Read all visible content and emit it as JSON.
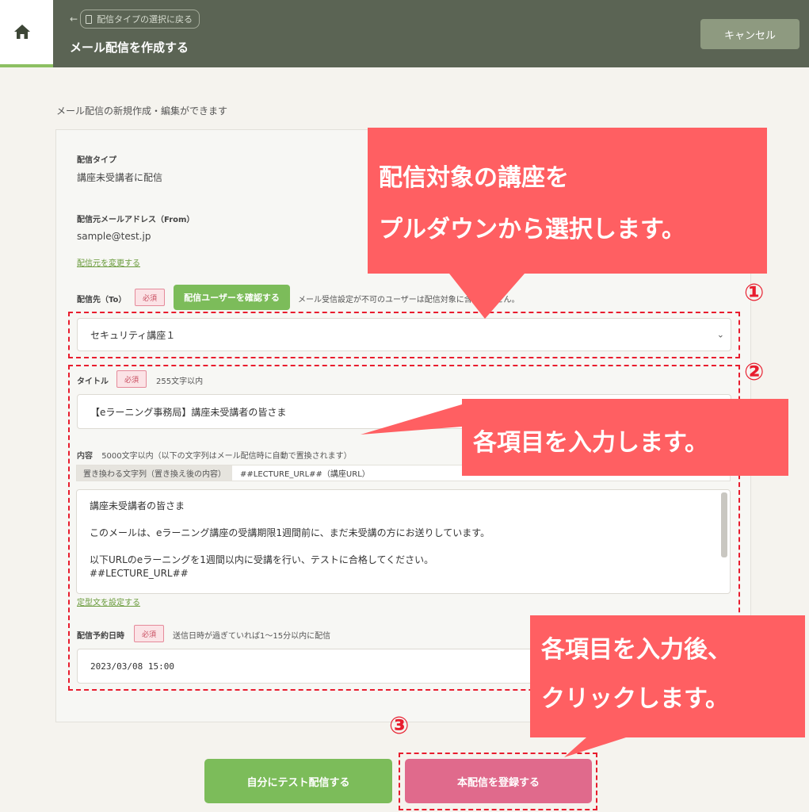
{
  "header": {
    "back_label": "配信タイプの選択に戻る",
    "back_arrow": "←",
    "title": "メール配信を作成する",
    "cancel_label": "キャンセル"
  },
  "subtitle": "メール配信の新規作成・編集ができます",
  "form": {
    "type_label": "配信タイプ",
    "type_value": "講座未受講者に配信",
    "from_label": "配信元メールアドレス（From）",
    "from_value": "sample@test.jp",
    "change_from_link": "配信元を変更する",
    "to_label": "配信先（To）",
    "required": "必須",
    "confirm_users_button": "配信ユーザーを確認する",
    "to_note": "メール受信設定が不可のユーザーは配信対象に含まれません。",
    "course_select": "セキュリティ講座１",
    "course_chevron": "⌄",
    "title_label": "タイトル",
    "title_note": "255文字以内",
    "title_value": "【eラーニング事務局】講座未受講者の皆さま",
    "content_label": "内容",
    "content_note": "5000文字以内（以下の文字列はメール配信時に自動で置換されます）",
    "replace_head": "置き換わる文字列（置き換え後の内容）",
    "replace_value": "##LECTURE_URL##（講座URL）",
    "body_lines": [
      "講座未受講者の皆さま",
      "このメールは、eラーニング講座の受講期限1週間前に、まだ未受講の方にお送りしています。",
      "以下URLのeラーニングを1週間以内に受講を行い、テストに合格してください。",
      "##LECTURE_URL##"
    ],
    "template_link": "定型文を設定する",
    "schedule_label": "配信予約日時",
    "schedule_note": "送信日時が過ぎていれば1〜15分以内に配信",
    "schedule_value": "2023/03/08 15:00"
  },
  "buttons": {
    "test_send": "自分にテスト配信する",
    "register": "本配信を登録する"
  },
  "annotations": {
    "num1": "①",
    "num2": "②",
    "num3": "③",
    "callout1_line1": "配信対象の講座を",
    "callout1_line2": "プルダウンから選択します。",
    "callout2": "各項目を入力します。",
    "callout3_line1": "各項目を入力後、",
    "callout3_line2": "クリックします。"
  },
  "colors": {
    "header_bg": "#5b6454",
    "green": "#7cbc5a",
    "pink": "#e06a8c",
    "callout": "#ff5f62",
    "dash": "#e81d2e"
  }
}
